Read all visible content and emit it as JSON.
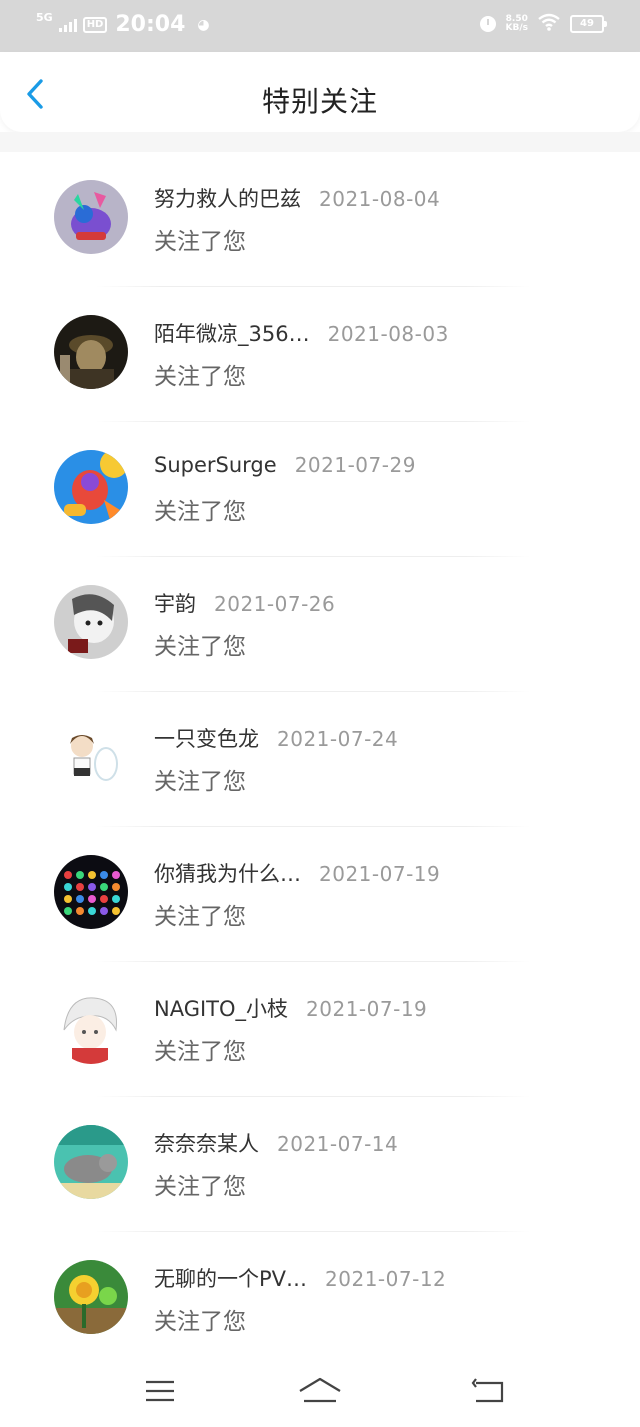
{
  "status_bar": {
    "network": "5G",
    "hd": "HD",
    "time": "20:04",
    "speed_value": "8.50",
    "speed_unit": "KB/s",
    "battery": "49"
  },
  "header": {
    "title": "特别关注",
    "back_icon": "chevron-left-icon",
    "accent": "#1a9be6"
  },
  "items": [
    {
      "name": "努力救人的巴兹",
      "date": "2021-08-04",
      "action": "关注了您"
    },
    {
      "name": "陌年微凉_356…",
      "date": "2021-08-03",
      "action": "关注了您"
    },
    {
      "name": "SuperSurge",
      "date": "2021-07-29",
      "action": "关注了您"
    },
    {
      "name": "宇韵",
      "date": "2021-07-26",
      "action": "关注了您"
    },
    {
      "name": "一只变色龙",
      "date": "2021-07-24",
      "action": "关注了您"
    },
    {
      "name": "你猜我为什么…",
      "date": "2021-07-19",
      "action": "关注了您"
    },
    {
      "name": "NAGITO_小枝",
      "date": "2021-07-19",
      "action": "关注了您"
    },
    {
      "name": "奈奈奈某人",
      "date": "2021-07-14",
      "action": "关注了您"
    },
    {
      "name": "无聊的一个PV…",
      "date": "2021-07-12",
      "action": "关注了您"
    }
  ],
  "nav": {
    "menu_icon": "menu-icon",
    "home_icon": "home-icon",
    "back_icon": "back-icon"
  }
}
